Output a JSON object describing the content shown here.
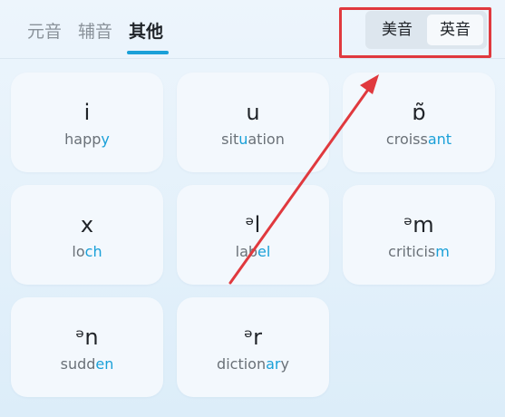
{
  "tabs": [
    {
      "label": "元音",
      "active": false
    },
    {
      "label": "辅音",
      "active": false
    },
    {
      "label": "其他",
      "active": true
    }
  ],
  "accent": {
    "us_label": "美音",
    "uk_label": "英音",
    "selected": "uk"
  },
  "colors": {
    "accent": "#1aa0d8",
    "annotation": "#e0393e"
  },
  "cards": [
    {
      "symbol": "i",
      "word_before": "happ",
      "word_highlight": "y",
      "word_after": ""
    },
    {
      "symbol": "u",
      "word_before": "sit",
      "word_highlight": "u",
      "word_after": "ation"
    },
    {
      "symbol": "ɒ̃",
      "word_before": "croiss",
      "word_highlight": "ant",
      "word_after": ""
    },
    {
      "symbol": "x",
      "word_before": "lo",
      "word_highlight": "ch",
      "word_after": ""
    },
    {
      "symbol": "ᵊl",
      "word_before": "lab",
      "word_highlight": "el",
      "word_after": ""
    },
    {
      "symbol": "ᵊm",
      "word_before": "criticis",
      "word_highlight": "m",
      "word_after": ""
    },
    {
      "symbol": "ᵊn",
      "word_before": "sudd",
      "word_highlight": "en",
      "word_after": ""
    },
    {
      "symbol": "ᵊr",
      "word_before": "diction",
      "word_highlight": "ar",
      "word_after": "y"
    }
  ]
}
